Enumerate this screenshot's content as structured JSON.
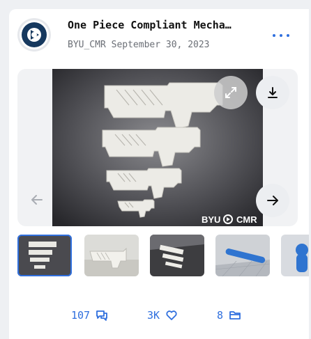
{
  "model": {
    "title": "One Piece Compliant Mecha…",
    "author": "BYU_CMR",
    "date": "September 30, 2023"
  },
  "icons": {
    "avatar": "byu-cmr-logo-icon",
    "more": "more-dots-icon",
    "expand": "expand-icon",
    "download": "download-icon",
    "prev": "arrow-left-icon",
    "next": "arrow-right-icon",
    "comments": "comments-icon",
    "likes": "heart-icon",
    "collections": "folder-icon"
  },
  "gallery": {
    "watermark": "BYU",
    "watermark_suffix": "CMR",
    "thumbnail_count_visible": 5,
    "active_index": 0
  },
  "stats": {
    "comments": "107",
    "likes": "3K",
    "collections": "8"
  },
  "colors": {
    "accent": "#2f6fde",
    "logo_dark": "#16385e"
  }
}
